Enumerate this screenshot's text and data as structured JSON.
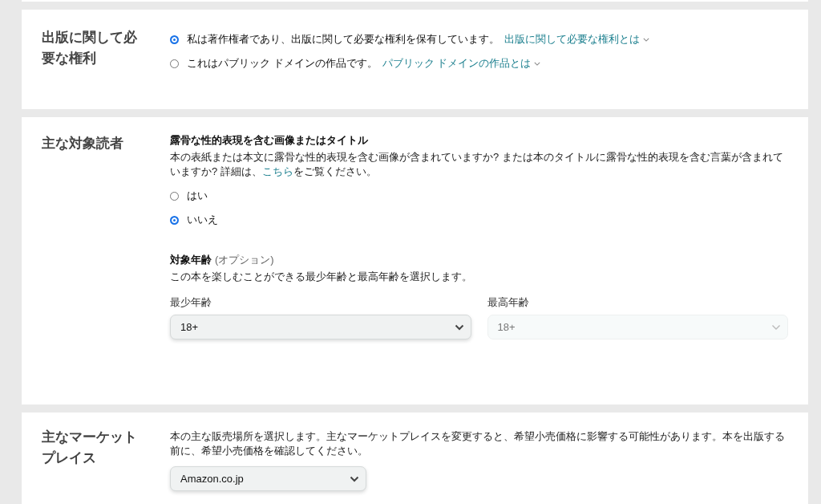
{
  "rights": {
    "heading": "出版に関して必要な権利",
    "options": [
      {
        "label": "私は著作権者であり、出版に関して必要な権利を保有しています。",
        "link": "出版に関して必要な権利とは",
        "selected": true
      },
      {
        "label": "これはパブリック ドメインの作品です。",
        "link": "パブリック ドメインの作品とは",
        "selected": false
      }
    ]
  },
  "audience": {
    "heading": "主な対象読者",
    "explicit_title": "露骨な性的表現を含む画像またはタイトル",
    "explicit_text_before": "本の表紙または本文に露骨な性的表現を含む画像が含まれていますか? または本のタイトルに露骨な性的表現を含む言葉が含まれていますか? 詳細は、",
    "explicit_link": "こちら",
    "explicit_text_after": "をご覧ください。",
    "explicit_options": [
      {
        "label": "はい",
        "selected": false
      },
      {
        "label": "いいえ",
        "selected": true
      }
    ],
    "age_title": "対象年齢",
    "age_optional": "(オプション)",
    "age_text": "この本を楽しむことができる最少年齢と最高年齢を選択します。",
    "ages": [
      {
        "label": "最少年齢",
        "value": "18+",
        "disabled": false
      },
      {
        "label": "最高年齢",
        "value": "18+",
        "disabled": true
      }
    ]
  },
  "marketplace": {
    "heading": "主なマーケットプレイス",
    "text": "本の主な販売場所を選択します。主なマーケットプレイスを変更すると、希望小売価格に影響する可能性があります。本を出版する前に、希望小売価格を確認してください。",
    "value": "Amazon.co.jp"
  }
}
